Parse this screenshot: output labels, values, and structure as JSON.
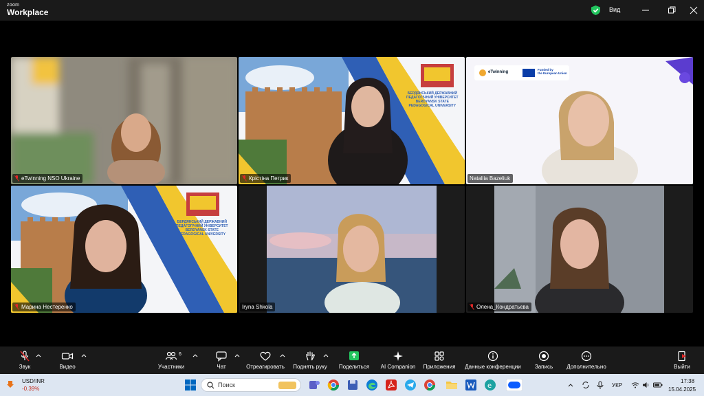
{
  "window": {
    "brand_small": "zoom",
    "brand_large": "Workplace",
    "view_label": "Вид"
  },
  "participants": [
    {
      "name": "eTwinning NSO Ukraine",
      "muted": true
    },
    {
      "name": "Крістіна Петрик",
      "muted": true
    },
    {
      "name": "Nataliia Bazeliuk",
      "muted": false,
      "active_speaker": true
    },
    {
      "name": "Марина Нестеренко",
      "muted": true
    },
    {
      "name": "Iryna Shkola",
      "muted": false
    },
    {
      "name": "Олена_Кондратьєва",
      "muted": true
    }
  ],
  "backgrounds": {
    "university_lines": [
      "БЕРДЯНСЬКИЙ ДЕРЖАВНИЙ",
      "ПЕДАГОГІЧНИЙ УНІВЕРСИТЕТ",
      "BERDYANSK STATE",
      "PEDAGOGICAL UNIVERSITY"
    ],
    "etwinning_text": "eTwinning",
    "eu_text_1": "Funded by",
    "eu_text_2": "the European Union"
  },
  "controls": [
    {
      "id": "audio",
      "label": "Звук",
      "icon": "mic-muted-icon"
    },
    {
      "id": "video",
      "label": "Видео",
      "icon": "camera-icon"
    },
    {
      "id": "participants",
      "label": "Участники",
      "icon": "participants-icon",
      "badge": "6"
    },
    {
      "id": "chat",
      "label": "Чат",
      "icon": "chat-icon"
    },
    {
      "id": "react",
      "label": "Отреагировать",
      "icon": "heart-icon"
    },
    {
      "id": "raise",
      "label": "Поднять руку",
      "icon": "hand-icon"
    },
    {
      "id": "share",
      "label": "Поделиться",
      "icon": "share-icon"
    },
    {
      "id": "ai",
      "label": "AI Companion",
      "icon": "sparkle-icon"
    },
    {
      "id": "apps",
      "label": "Приложения",
      "icon": "apps-icon"
    },
    {
      "id": "info",
      "label": "Данные конференции",
      "icon": "info-icon"
    },
    {
      "id": "record",
      "label": "Запись",
      "icon": "record-icon"
    },
    {
      "id": "more",
      "label": "Дополнительно",
      "icon": "more-icon"
    },
    {
      "id": "leave",
      "label": "Выйти",
      "icon": "leave-icon"
    }
  ],
  "taskbar": {
    "ticker_name": "USD/INR",
    "ticker_change": "-0.39%",
    "search_placeholder": "Поиск",
    "language": "УКР",
    "time": "17:38",
    "date": "15.04.2025"
  },
  "colors": {
    "active_speaker": "#2ad38d",
    "share_green": "#22c55e",
    "accent_blue": "#0b5cff",
    "ticker_negative": "#c42b1c"
  }
}
